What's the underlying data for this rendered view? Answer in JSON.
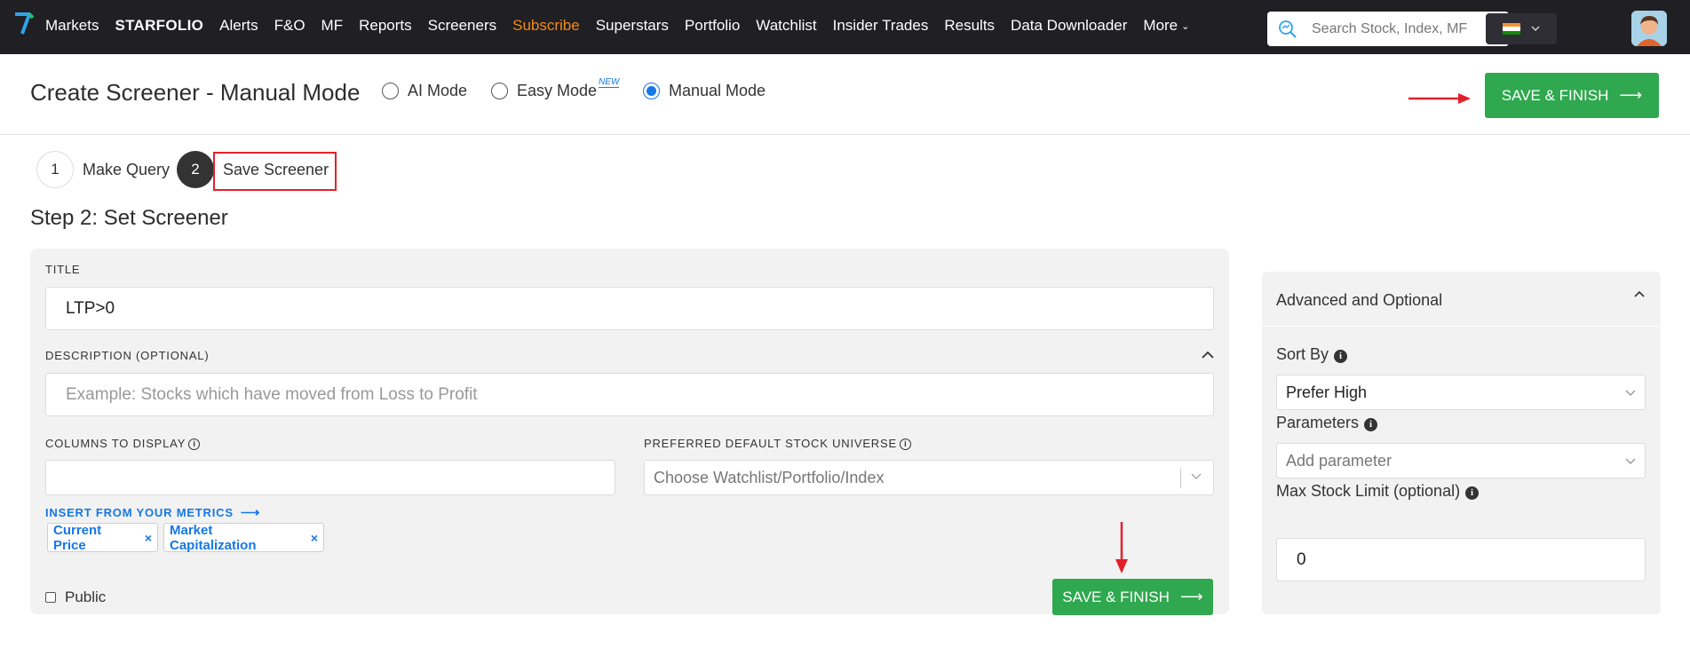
{
  "nav": {
    "items": [
      {
        "label": "Markets",
        "style": "normal"
      },
      {
        "label": "STARFOLIO",
        "style": "brand"
      },
      {
        "label": "Alerts",
        "style": "normal"
      },
      {
        "label": "F&O",
        "style": "normal"
      },
      {
        "label": "MF",
        "style": "normal"
      },
      {
        "label": "Reports",
        "style": "normal"
      },
      {
        "label": "Screeners",
        "style": "normal"
      },
      {
        "label": "Subscribe",
        "style": "subscribe"
      },
      {
        "label": "Superstars",
        "style": "normal"
      },
      {
        "label": "Portfolio",
        "style": "normal"
      },
      {
        "label": "Watchlist",
        "style": "normal"
      },
      {
        "label": "Insider Trades",
        "style": "normal"
      },
      {
        "label": "Results",
        "style": "normal"
      },
      {
        "label": "Data Downloader",
        "style": "normal"
      }
    ],
    "more_label": "More",
    "search_placeholder": "Search Stock, Index, MF",
    "colors": {
      "bar": "#1f1f24",
      "subscribe": "#f08a1c"
    }
  },
  "header": {
    "title": "Create Screener - Manual Mode",
    "modes": [
      {
        "label": "AI Mode",
        "selected": false
      },
      {
        "label": "Easy Mode",
        "selected": false,
        "badge": "NEW"
      },
      {
        "label": "Manual Mode",
        "selected": true
      }
    ],
    "save_label": "SAVE & FINISH"
  },
  "stepper": {
    "steps": [
      {
        "num": "1",
        "label": "Make Query",
        "active": false
      },
      {
        "num": "2",
        "label": "Save Screener",
        "active": true
      }
    ],
    "heading": "Step 2: Set Screener"
  },
  "form": {
    "title_label": "TITLE",
    "title_value": "LTP>0",
    "description_label": "DESCRIPTION (OPTIONAL)",
    "description_placeholder": "Example: Stocks which have moved from Loss to Profit",
    "columns_label": "COLUMNS TO DISPLAY",
    "universe_label": "PREFERRED DEFAULT STOCK UNIVERSE",
    "universe_placeholder": "Choose Watchlist/Portfolio/Index",
    "insert_link": "INSERT FROM YOUR METRICS",
    "chips": [
      "Current Price",
      "Market Capitalization"
    ],
    "public_label": "Public",
    "save_label": "SAVE & FINISH"
  },
  "advanced": {
    "title": "Advanced and Optional",
    "sort_label": "Sort By",
    "sort_value": "Prefer High",
    "params_label": "Parameters",
    "params_placeholder": "Add parameter",
    "max_label": "Max Stock Limit (optional)",
    "max_value": "0"
  },
  "colors": {
    "green": "#2fa84f",
    "blue": "#1677e5",
    "annotation_red": "#e3202a"
  }
}
